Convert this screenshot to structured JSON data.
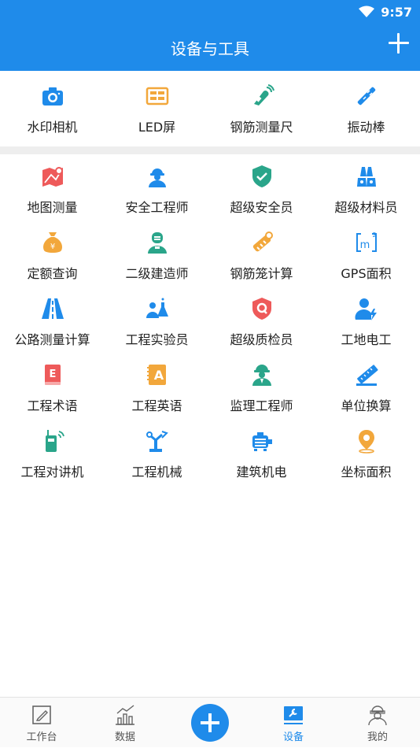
{
  "status_bar": {
    "time": "9:57"
  },
  "header": {
    "title": "设备与工具"
  },
  "top_tools": [
    {
      "label": "水印相机",
      "icon": "camera-icon",
      "color": "#1f8bea"
    },
    {
      "label": "LED屏",
      "icon": "led-screen-icon",
      "color": "#f2a73b"
    },
    {
      "label": "钢筋测量尺",
      "icon": "rebar-measure-icon",
      "color": "#2aa58a"
    },
    {
      "label": "振动棒",
      "icon": "vibrator-icon",
      "color": "#1f8bea"
    }
  ],
  "tools": [
    {
      "label": "地图测量",
      "icon": "map-measure-icon",
      "color": "#ee5a5a"
    },
    {
      "label": "安全工程师",
      "icon": "safety-engineer-icon",
      "color": "#1f8bea"
    },
    {
      "label": "超级安全员",
      "icon": "shield-check-icon",
      "color": "#2aa58a"
    },
    {
      "label": "超级材料员",
      "icon": "materials-icon",
      "color": "#1f8bea"
    },
    {
      "label": "定额查询",
      "icon": "money-bag-icon",
      "color": "#f2a73b"
    },
    {
      "label": "二级建造师",
      "icon": "constructor-icon",
      "color": "#2aa58a"
    },
    {
      "label": "钢筋笼计算",
      "icon": "rebar-cage-icon",
      "color": "#f2a73b"
    },
    {
      "label": "GPS面积",
      "icon": "area-m2-icon",
      "color": "#1f8bea"
    },
    {
      "label": "公路测量计算",
      "icon": "road-icon",
      "color": "#1f8bea"
    },
    {
      "label": "工程实验员",
      "icon": "lab-tester-icon",
      "color": "#1f8bea"
    },
    {
      "label": "超级质检员",
      "icon": "quality-shield-icon",
      "color": "#ee5a5a"
    },
    {
      "label": "工地电工",
      "icon": "electrician-icon",
      "color": "#1f8bea"
    },
    {
      "label": "工程术语",
      "icon": "glossary-book-icon",
      "color": "#ee5a5a"
    },
    {
      "label": "工程英语",
      "icon": "english-book-icon",
      "color": "#f2a73b"
    },
    {
      "label": "监理工程师",
      "icon": "supervisor-icon",
      "color": "#2aa58a"
    },
    {
      "label": "单位换算",
      "icon": "ruler-icon",
      "color": "#1f8bea"
    },
    {
      "label": "工程对讲机",
      "icon": "walkie-talkie-icon",
      "color": "#2aa58a"
    },
    {
      "label": "工程机械",
      "icon": "machinery-arm-icon",
      "color": "#1f8bea"
    },
    {
      "label": "建筑机电",
      "icon": "motor-icon",
      "color": "#1f8bea"
    },
    {
      "label": "坐标面积",
      "icon": "location-pin-icon",
      "color": "#f2a73b"
    }
  ],
  "bottom_nav": [
    {
      "label": "工作台",
      "icon": "workbench-icon",
      "active": false
    },
    {
      "label": "数据",
      "icon": "data-chart-icon",
      "active": false
    },
    {
      "label": "设备",
      "icon": "devices-icon",
      "active": true
    },
    {
      "label": "我的",
      "icon": "profile-icon",
      "active": false
    }
  ],
  "colors": {
    "primary": "#1f8bea",
    "red": "#ee5a5a",
    "orange": "#f2a73b",
    "green": "#2aa58a"
  }
}
